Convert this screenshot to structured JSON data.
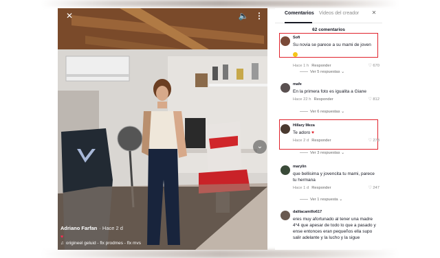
{
  "video": {
    "author": "Adriano Farfan",
    "posted": "· Hace 2 d",
    "sound": "origineel geluid - flx prodmes - flx mvs",
    "close_glyph": "✕",
    "sound_glyph": "🔈",
    "more_glyph": "⋮",
    "next_glyph": "⌄",
    "heart_glyph": "♥",
    "note_glyph": "♫"
  },
  "panel": {
    "tabs": [
      "Comentarios",
      "Videos del creador"
    ],
    "close_glyph": "✕",
    "count": "62 comentarios"
  },
  "colors": {
    "highlight": "#e0202a",
    "accent": "#ff2b55"
  },
  "comments": [
    {
      "user": "Sofi",
      "text": "Su novia se parece a su mami de joven",
      "time": "Hace 1 h",
      "reply": "Responder",
      "likes": "670",
      "replies": "Ver 5 respuestas",
      "highlighted": true
    },
    {
      "user": "mafe",
      "text": "En la primera foto es igualita a Giane",
      "time": "Hace 22 h",
      "reply": "Responder",
      "likes": "812",
      "replies": "Ver 6 respuestas",
      "highlighted": false
    },
    {
      "user": "Hillary Meza",
      "text": "Te adoro",
      "time": "Hace 2 d",
      "reply": "Responder",
      "likes": "278",
      "replies": "Ver 3 respuestas",
      "highlighted": true
    },
    {
      "user": "marylin",
      "text": "que bellisima y jovencita tu mami, parece tu hermana",
      "time": "Hace 1 d",
      "reply": "Responder",
      "likes": "247",
      "replies": "Ver 1 respuesta",
      "highlighted": false
    },
    {
      "user": "dalilacamillo617",
      "text": "eres muy afortunado al tener una madre 4*4 que apesar de todo lo que a pasado y ense entonces eran pequeños ella supo salir adelante y la lucho y la sigue",
      "time": "",
      "reply": "",
      "likes": "",
      "replies": "",
      "highlighted": false
    }
  ]
}
